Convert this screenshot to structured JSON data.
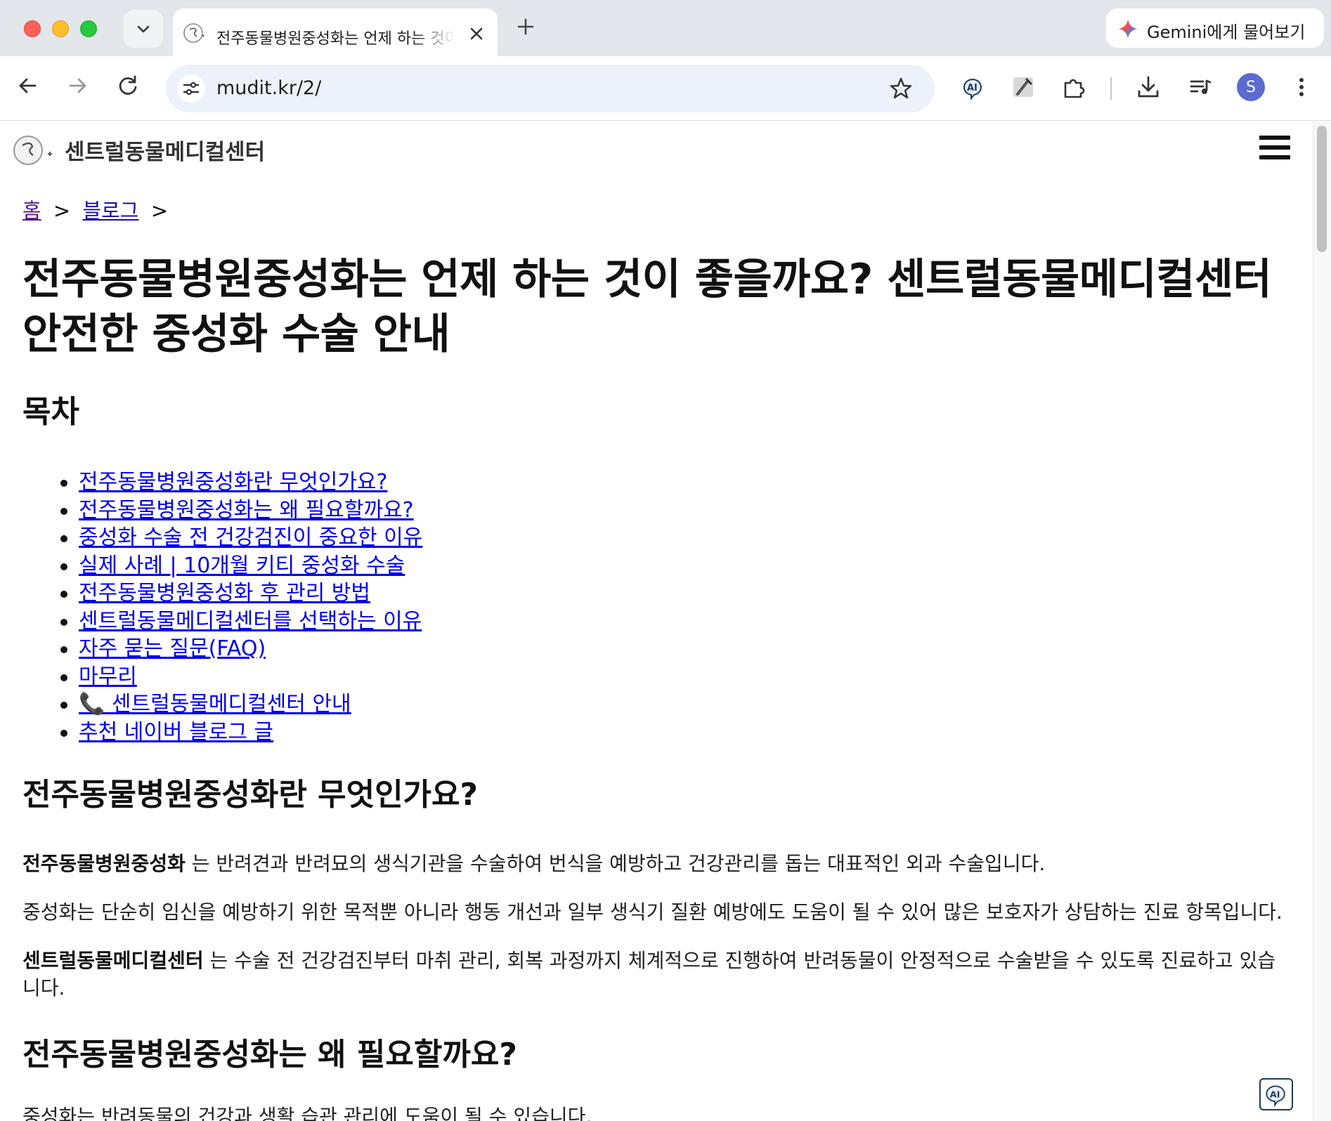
{
  "browser": {
    "tab": {
      "title": "전주동물병원중성화는 언제 하는 것이 좋을까요? 센트럴동물메디컬센터 안전한 중성화 수술 안내",
      "favicon": "paw-logo-icon",
      "close_icon": "close-icon"
    },
    "tab_menu_icon": "chevron-down-icon",
    "new_tab_icon": "plus-icon",
    "gemini": {
      "label": "Gemini에게 물어보기",
      "icon": "gemini-sparkle-icon"
    },
    "toolbar": {
      "back_icon": "back-arrow-icon",
      "forward_icon": "forward-arrow-icon",
      "reload_icon": "reload-icon",
      "site_info_icon": "tune-icon",
      "url": "mudit.kr/2/",
      "bookmark_icon": "star-icon",
      "extensions": [
        "ai-extension-icon",
        "dropper-icon",
        "puzzle-icon"
      ],
      "download_icon": "download-icon",
      "reading_list_icon": "media-queue-icon",
      "avatar_letter": "S",
      "menu_icon": "kebab-menu-icon"
    }
  },
  "page": {
    "site_name": "센트럴동물메디컬센터",
    "breadcrumb": {
      "home": "홈",
      "separator": ">",
      "blog": "블로그"
    },
    "title": "전주동물병원중성화는 언제 하는 것이 좋을까요? 센트럴동물메디컬센터 안전한 중성화 수술 안내",
    "toc_title": "목차",
    "toc": [
      "전주동물병원중성화란 무엇인가요?",
      "전주동물병원중성화는 왜 필요할까요?",
      "중성화 수술 전 건강검진이 중요한 이유",
      "실제 사례 | 10개월 키티 중성화 수술",
      "전주동물병원중성화 후 관리 방법",
      "센트럴동물메디컬센터를 선택하는 이유",
      "자주 묻는 질문(FAQ)",
      "마무리",
      "📞 센트럴동물메디컬센터 안내",
      "추천 네이버 블로그 글"
    ],
    "section1": {
      "heading": "전주동물병원중성화란 무엇인가요?",
      "p1_bold": "전주동물병원중성화",
      "p1_rest": " 는 반려견과 반려묘의 생식기관을 수술하여 번식을 예방하고 건강관리를 돕는 대표적인 외과 수술입니다.",
      "p2": "중성화는 단순히 임신을 예방하기 위한 목적뿐 아니라 행동 개선과 일부 생식기 질환 예방에도 도움이 될 수 있어 많은 보호자가 상담하는 진료 항목입니다.",
      "p3_bold": "센트럴동물메디컬센터",
      "p3_rest": " 는 수술 전 건강검진부터 마취 관리, 회복 과정까지 체계적으로 진행하여 반려동물이 안정적으로 수술받을 수 있도록 진료하고 있습니다."
    },
    "section2": {
      "heading": "전주동물병원중성화는 왜 필요할까요?",
      "p1": "중성화는 반려동물의 건강과 생활 습관 관리에 도움이 될 수 있습니다."
    },
    "floating_icon": "ai-extension-icon"
  }
}
